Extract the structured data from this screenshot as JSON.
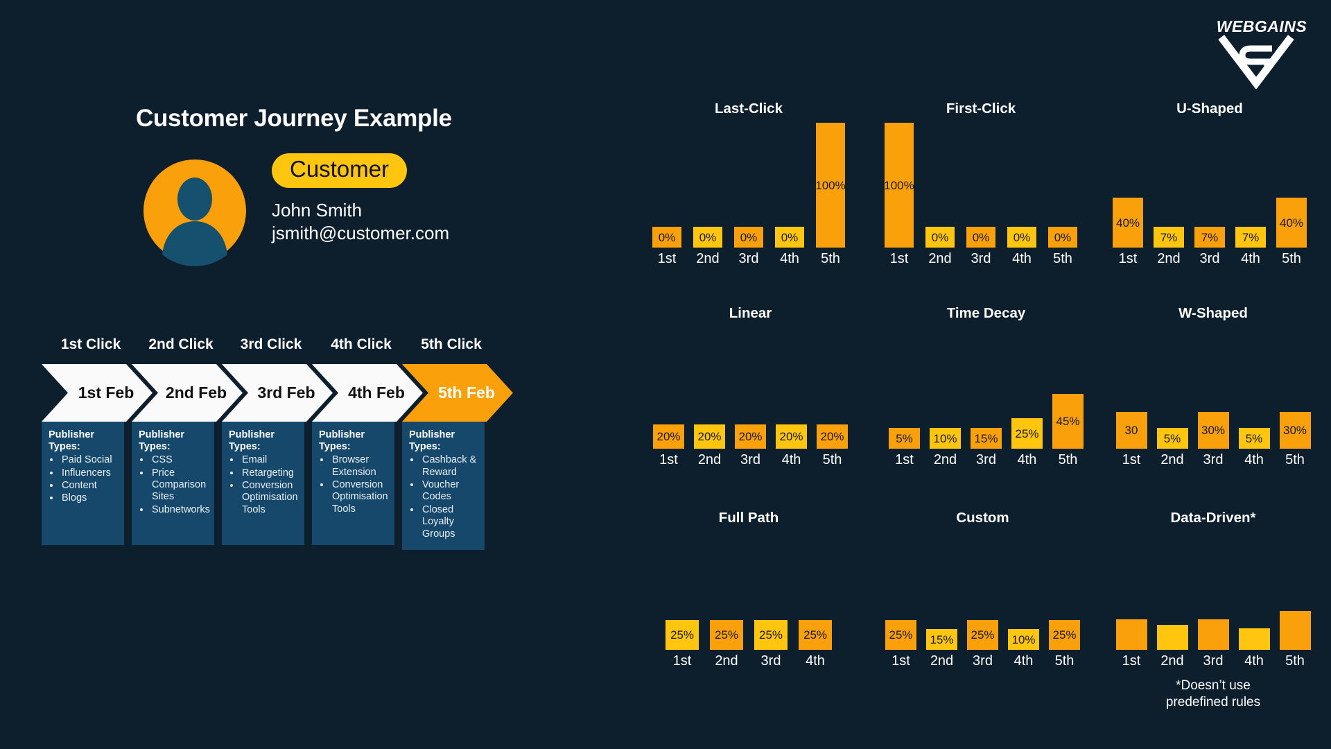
{
  "brand": {
    "logo_text": "WEBGAINS",
    "background_color": "#0d1e2d",
    "accent_orange": "#f9a00b",
    "accent_yellow": "#ffc50f",
    "card_blue": "#15486a"
  },
  "left": {
    "title": "Customer Journey Example",
    "customer_pill": "Customer",
    "customer_name": "John Smith",
    "customer_email": "jsmith@customer.com"
  },
  "journey": {
    "columns": [
      {
        "head": "1st Click",
        "date": "1st Feb",
        "highlighted": false,
        "card_title": "Publisher Types:",
        "publisher_types": [
          "Paid Social",
          "Influencers",
          "Content",
          "Blogs"
        ]
      },
      {
        "head": "2nd Click",
        "date": "2nd Feb",
        "highlighted": false,
        "card_title": "Publisher Types:",
        "publisher_types": [
          "CSS",
          "Price Comparison Sites",
          "Subnetworks"
        ]
      },
      {
        "head": "3rd Click",
        "date": "3rd Feb",
        "highlighted": false,
        "card_title": "Publisher Types:",
        "publisher_types": [
          "Email",
          "Retargeting",
          "Conversion Optimisation Tools"
        ]
      },
      {
        "head": "4th Click",
        "date": "4th Feb",
        "highlighted": false,
        "card_title": "Publisher Types:",
        "publisher_types": [
          "Browser Extension",
          "Conversion Optimisation Tools"
        ]
      },
      {
        "head": "5th Click",
        "date": "5th Feb",
        "highlighted": true,
        "card_title": "Publisher Types:",
        "publisher_types": [
          "Cashback & Reward",
          "Voucher Codes",
          "Closed Loyalty Groups"
        ]
      }
    ]
  },
  "chart_data": [
    {
      "id": "last-click",
      "type": "bar",
      "title": "Last-Click",
      "categories": [
        "1st",
        "2nd",
        "3rd",
        "4th",
        "5th"
      ],
      "values": [
        0,
        0,
        0,
        0,
        100
      ],
      "labels": [
        "0%",
        "0%",
        "0%",
        "0%",
        "100%"
      ],
      "colors": [
        "#f9a00b",
        "#ffc50f",
        "#f9a00b",
        "#ffc50f",
        "#f9a00b"
      ],
      "ylim": [
        0,
        100
      ],
      "xlabel": "",
      "ylabel": "",
      "grid": false,
      "legend": "none"
    },
    {
      "id": "first-click",
      "type": "bar",
      "title": "First-Click",
      "categories": [
        "1st",
        "2nd",
        "3rd",
        "4th",
        "5th"
      ],
      "values": [
        100,
        0,
        0,
        0,
        0
      ],
      "labels": [
        "100%",
        "0%",
        "0%",
        "0%",
        "0%"
      ],
      "colors": [
        "#f9a00b",
        "#ffc50f",
        "#f9a00b",
        "#ffc50f",
        "#f9a00b"
      ],
      "ylim": [
        0,
        100
      ],
      "xlabel": "",
      "ylabel": "",
      "grid": false,
      "legend": "none"
    },
    {
      "id": "u-shaped",
      "type": "bar",
      "title": "U-Shaped",
      "categories": [
        "1st",
        "2nd",
        "3rd",
        "4th",
        "5th"
      ],
      "values": [
        40,
        7,
        7,
        7,
        40
      ],
      "labels": [
        "40%",
        "7%",
        "7%",
        "7%",
        "40%"
      ],
      "colors": [
        "#f9a00b",
        "#ffc50f",
        "#f9a00b",
        "#ffc50f",
        "#f9a00b"
      ],
      "ylim": [
        0,
        100
      ],
      "xlabel": "",
      "ylabel": "",
      "grid": false,
      "legend": "none"
    },
    {
      "id": "linear",
      "type": "bar",
      "title": "Linear",
      "categories": [
        "1st",
        "2nd",
        "3rd",
        "4th",
        "5th"
      ],
      "values": [
        20,
        20,
        20,
        20,
        20
      ],
      "labels": [
        "20%",
        "20%",
        "20%",
        "20%",
        "20%"
      ],
      "colors": [
        "#f9a00b",
        "#ffc50f",
        "#f9a00b",
        "#ffc50f",
        "#f9a00b"
      ],
      "ylim": [
        0,
        100
      ],
      "xlabel": "",
      "ylabel": "",
      "grid": false,
      "legend": "none"
    },
    {
      "id": "time-decay",
      "type": "bar",
      "title": "Time Decay",
      "categories": [
        "1st",
        "2nd",
        "3rd",
        "4th",
        "5th"
      ],
      "values": [
        5,
        10,
        15,
        25,
        45
      ],
      "labels": [
        "5%",
        "10%",
        "15%",
        "25%",
        "45%"
      ],
      "colors": [
        "#f9a00b",
        "#ffc50f",
        "#f9a00b",
        "#ffc50f",
        "#f9a00b"
      ],
      "ylim": [
        0,
        100
      ],
      "xlabel": "",
      "ylabel": "",
      "grid": false,
      "legend": "none"
    },
    {
      "id": "w-shaped",
      "type": "bar",
      "title": "W-Shaped",
      "categories": [
        "1st",
        "2nd",
        "3rd",
        "4th",
        "5th"
      ],
      "values": [
        30,
        5,
        30,
        5,
        30
      ],
      "labels": [
        "30",
        "5%",
        "30%",
        "5%",
        "30%"
      ],
      "colors": [
        "#f9a00b",
        "#ffc50f",
        "#f9a00b",
        "#ffc50f",
        "#f9a00b"
      ],
      "ylim": [
        0,
        100
      ],
      "xlabel": "",
      "ylabel": "",
      "grid": false,
      "legend": "none"
    },
    {
      "id": "full-path",
      "type": "bar",
      "title": "Full Path",
      "categories": [
        "1st",
        "2nd",
        "3rd",
        "4th"
      ],
      "values": [
        25,
        25,
        25,
        25
      ],
      "labels": [
        "25%",
        "25%",
        "25%",
        "25%"
      ],
      "colors": [
        "#ffc50f",
        "#f9a00b",
        "#ffc50f",
        "#f9a00b"
      ],
      "ylim": [
        0,
        100
      ],
      "xlabel": "",
      "ylabel": "",
      "grid": false,
      "legend": "none"
    },
    {
      "id": "custom",
      "type": "bar",
      "title": "Custom",
      "categories": [
        "1st",
        "2nd",
        "3rd",
        "4th",
        "5th"
      ],
      "values": [
        25,
        15,
        25,
        10,
        25
      ],
      "labels": [
        "25%",
        "15%",
        "25%",
        "10%",
        "25%"
      ],
      "colors": [
        "#f9a00b",
        "#ffc50f",
        "#f9a00b",
        "#ffc50f",
        "#f9a00b"
      ],
      "ylim": [
        0,
        100
      ],
      "xlabel": "",
      "ylabel": "",
      "grid": false,
      "legend": "none"
    },
    {
      "id": "data-driven",
      "type": "bar",
      "title": "Data-Driven*",
      "categories": [
        "1st",
        "2nd",
        "3rd",
        "4th",
        "5th"
      ],
      "values": [
        26,
        21,
        26,
        18,
        33
      ],
      "labels": [
        "",
        "",
        "",
        "",
        ""
      ],
      "colors": [
        "#f9a00b",
        "#ffc50f",
        "#f9a00b",
        "#ffc50f",
        "#f9a00b"
      ],
      "footnote": "*Doesn’t use\npredefined rules",
      "ylim": [
        0,
        100
      ],
      "xlabel": "",
      "ylabel": "",
      "grid": false,
      "legend": "none"
    }
  ]
}
